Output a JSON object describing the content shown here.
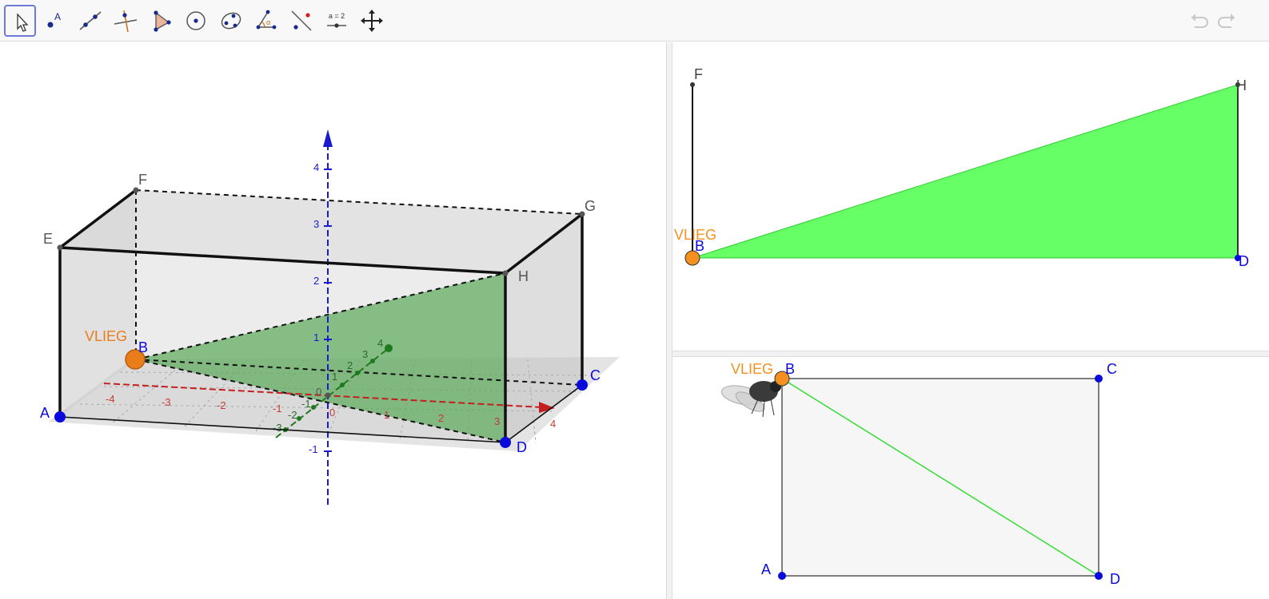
{
  "toolbar": {
    "tools": [
      {
        "name": "move-tool",
        "icon": "arrow-cursor-icon",
        "active": true
      },
      {
        "name": "point-tool",
        "icon": "point-icon",
        "label": "A"
      },
      {
        "name": "line-tool",
        "icon": "line-icon"
      },
      {
        "name": "perpendicular-line-tool",
        "icon": "perpendicular-line-icon"
      },
      {
        "name": "polygon-tool",
        "icon": "polygon-icon"
      },
      {
        "name": "circle-tool",
        "icon": "circle-with-center-icon"
      },
      {
        "name": "conic-tool",
        "icon": "ellipse-icon"
      },
      {
        "name": "angle-tool",
        "icon": "angle-icon",
        "label": "α"
      },
      {
        "name": "reflect-tool",
        "icon": "reflect-icon"
      },
      {
        "name": "slider-tool",
        "icon": "slider-icon",
        "label": "a = 2"
      },
      {
        "name": "move-graphics-tool",
        "icon": "move-arrows-icon"
      }
    ],
    "undo_icon": "undo-icon",
    "redo_icon": "redo-icon"
  },
  "view3d": {
    "points": {
      "A": "A",
      "B": "B",
      "C": "C",
      "D": "D",
      "E": "E",
      "F": "F",
      "G": "G",
      "H": "H"
    },
    "vlieg_label": "VLIEG",
    "z_ticks": [
      "4",
      "3",
      "2",
      "1",
      "-1"
    ],
    "x_ticks": [
      "-4",
      "-3",
      "-2",
      "-1",
      "1",
      "2",
      "3",
      "4"
    ],
    "y_ticks": [
      "-3",
      "-2",
      "-1",
      "1",
      "2",
      "3",
      "4"
    ],
    "origin_labels": [
      "0",
      "0"
    ],
    "colors": {
      "z_axis": "#1a1ad0",
      "x_axis": "#c41f1f",
      "y_axis": "#1d7a1d",
      "plane": "#6fb36f",
      "vlieg": "#e87d1a",
      "point": "#0a0adc"
    }
  },
  "viewTop": {
    "points": {
      "F": "F",
      "B": "B",
      "H": "H",
      "D": "D"
    },
    "vlieg_label": "VLIEG",
    "colors": {
      "triangle": "#66ff66",
      "vlieg": "#f39020"
    }
  },
  "viewBottom": {
    "points": {
      "A": "A",
      "B": "B",
      "C": "C",
      "D": "D"
    },
    "vlieg_label": "VLIEG",
    "colors": {
      "diagonal": "#33dd33",
      "vlieg": "#f39020"
    }
  }
}
